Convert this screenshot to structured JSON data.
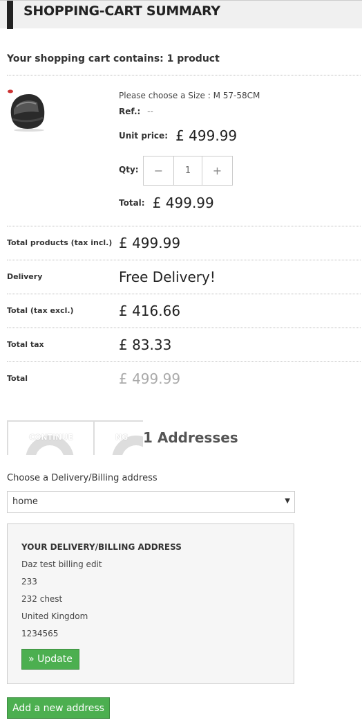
{
  "header": {
    "title": "SHOPPING-CART SUMMARY"
  },
  "cart": {
    "count_text": "Your shopping cart contains: 1 product"
  },
  "product": {
    "image_icon": "helmet-image",
    "size_text": "Please choose a Size : M 57-58CM",
    "ref_label": "Ref.:",
    "ref_value": "--",
    "unit_price_label": "Unit price:",
    "unit_price": "£ 499.99",
    "qty_label": "Qty:",
    "qty_value": "1",
    "minus_symbol": "−",
    "plus_symbol": "+",
    "total_label": "Total:",
    "total": "£ 499.99"
  },
  "summary": [
    {
      "label": "Total products (tax incl.)",
      "value": "£ 499.99"
    },
    {
      "label": "Delivery",
      "value": "Free Delivery!"
    },
    {
      "label": "Total (tax excl.)",
      "value": "£ 416.66"
    },
    {
      "label": "Total tax",
      "value": "£ 83.33"
    },
    {
      "label": "Total",
      "value": "£ 499.99"
    }
  ],
  "tabs": [
    {
      "label": "CONTINUE"
    },
    {
      "label": "NG"
    }
  ],
  "addresses": {
    "heading": "1 Addresses",
    "choose_label": "Choose a Delivery/Billing address",
    "selected": "home",
    "box_title": "YOUR DELIVERY/BILLING ADDRESS",
    "lines": [
      "Daz test billing edit",
      "233",
      "232 chest",
      "United Kingdom",
      "1234565"
    ],
    "update_button": "» Update",
    "add_button": "Add a new address"
  },
  "colors": {
    "accent": "#4caf50",
    "header_bar": "#222222"
  }
}
